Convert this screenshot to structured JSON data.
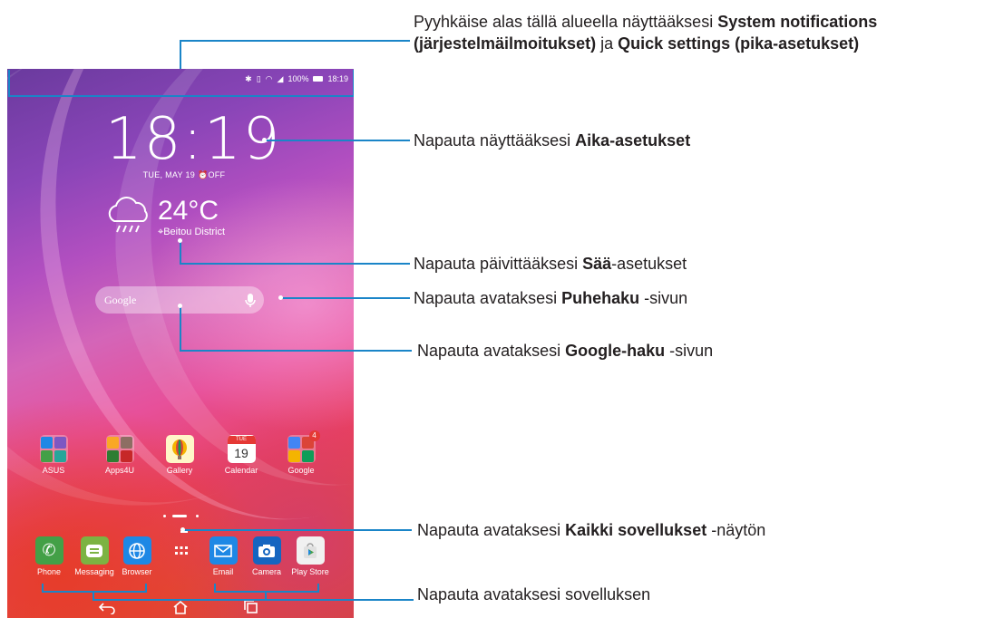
{
  "status_bar": {
    "battery": "100%",
    "time": "18:19"
  },
  "clock": {
    "time": "18:19",
    "date": "TUE, MAY 19",
    "alarm": "OFF"
  },
  "weather": {
    "temperature": "24°C",
    "location": "Beitou District"
  },
  "search": {
    "placeholder": "Google"
  },
  "apps": [
    {
      "label": "ASUS"
    },
    {
      "label": "Apps4U"
    },
    {
      "label": "Gallery"
    },
    {
      "label": "Calendar",
      "day_name": "TUE",
      "day": "19"
    },
    {
      "label": "Google",
      "badge": "4"
    }
  ],
  "dock": [
    {
      "label": "Phone"
    },
    {
      "label": "Messaging"
    },
    {
      "label": "Browser"
    },
    {
      "label": "Email"
    },
    {
      "label": "Camera"
    },
    {
      "label": "Play Store"
    }
  ],
  "callouts": {
    "notifications": {
      "pre": "Pyyhkäise alas tällä alueella näyttääksesi ",
      "b1": "System notifications",
      "b2": "(järjestelmäilmoitukset)",
      "mid": " ja ",
      "b3": "Quick settings (pika-asetukset)"
    },
    "time_settings": {
      "pre": "Napauta näyttääksesi ",
      "b": "Aika-asetukset",
      "post": ""
    },
    "weather": {
      "pre": "Napauta päivittääksesi ",
      "b": "Sää",
      "post": "-asetukset"
    },
    "voice_search": {
      "pre": "Napauta avataksesi ",
      "b": "Puhehaku",
      "post": " -sivun"
    },
    "google_search": {
      "pre": "Napauta avataksesi ",
      "b": "Google-haku",
      "post": " -sivun"
    },
    "all_apps": {
      "pre": "Napauta avataksesi ",
      "b": "Kaikki sovellukset",
      "post": " -näytön"
    },
    "open_app": {
      "pre": "Napauta avataksesi sovelluksen",
      "b": "",
      "post": ""
    }
  },
  "colors": {
    "callout_line": "#1a85c8"
  }
}
